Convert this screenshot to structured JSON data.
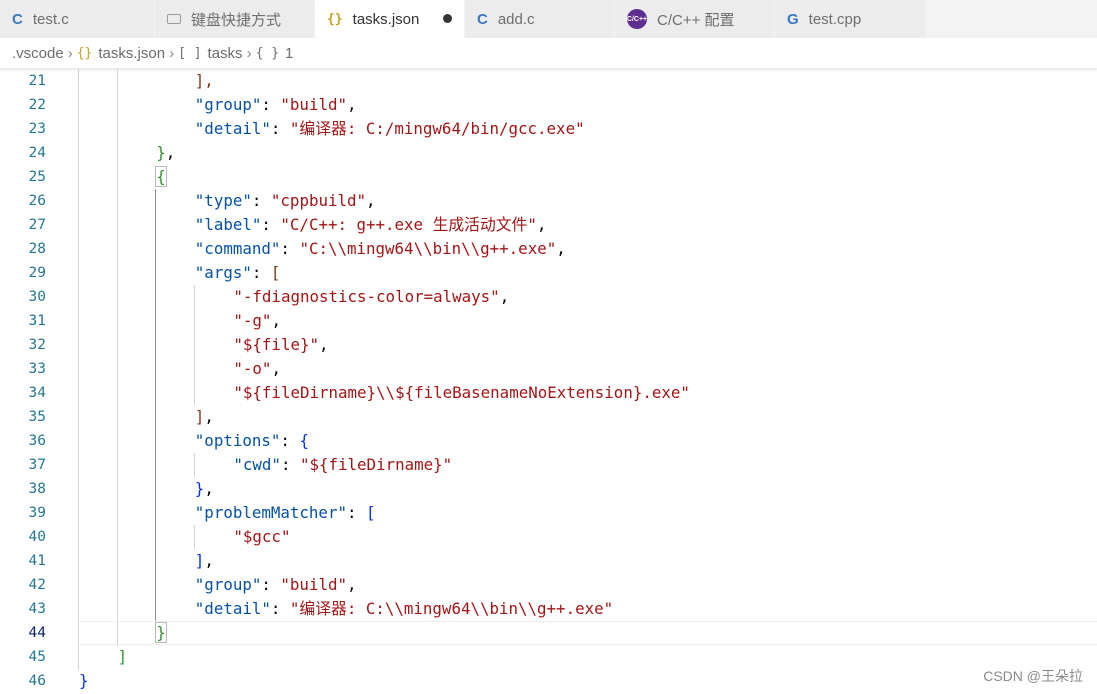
{
  "tabs": [
    {
      "label": "test.c",
      "icon": "c-file-icon",
      "glyph": "C",
      "active": false,
      "dirty": false,
      "width": 155
    },
    {
      "label": "键盘快捷方式",
      "icon": "keyboard-icon",
      "glyph": "",
      "active": false,
      "dirty": false,
      "width": 160
    },
    {
      "label": "tasks.json",
      "icon": "json-file-icon",
      "glyph": "{}",
      "active": true,
      "dirty": true,
      "width": 150
    },
    {
      "label": "add.c",
      "icon": "c-file-icon",
      "glyph": "C",
      "active": false,
      "dirty": false,
      "width": 150
    },
    {
      "label": "C/C++ 配置",
      "icon": "cpp-config-icon",
      "glyph": "C/C++",
      "active": false,
      "dirty": false,
      "width": 160
    },
    {
      "label": "test.cpp",
      "icon": "cpp-file-icon",
      "glyph": "G",
      "active": false,
      "dirty": false,
      "width": 152
    }
  ],
  "breadcrumb": [
    {
      "label": ".vscode",
      "glyph": ""
    },
    {
      "label": "tasks.json",
      "glyph": "{}"
    },
    {
      "label": "tasks",
      "glyph": "[ ]"
    },
    {
      "label": "1",
      "glyph": "{ }"
    }
  ],
  "editor": {
    "current_line": 44,
    "lines": [
      {
        "n": "21",
        "indent": 3,
        "tokens": [
          {
            "t": "],",
            "c": "b3"
          }
        ]
      },
      {
        "n": "22",
        "indent": 3,
        "tokens": [
          {
            "t": "\"group\"",
            "c": "k"
          },
          {
            "t": ": ",
            "c": "p"
          },
          {
            "t": "\"build\"",
            "c": "s"
          },
          {
            "t": ",",
            "c": "p"
          }
        ]
      },
      {
        "n": "23",
        "indent": 3,
        "tokens": [
          {
            "t": "\"detail\"",
            "c": "k"
          },
          {
            "t": ": ",
            "c": "p"
          },
          {
            "t": "\"编译器: C:/mingw64/bin/gcc.exe\"",
            "c": "s"
          }
        ]
      },
      {
        "n": "24",
        "indent": 2,
        "tokens": [
          {
            "t": "}",
            "c": "b2"
          },
          {
            "t": ",",
            "c": "p"
          }
        ]
      },
      {
        "n": "25",
        "indent": 2,
        "tokens": [
          {
            "t": "{",
            "c": "b2",
            "m": true
          }
        ]
      },
      {
        "n": "26",
        "indent": 3,
        "tokens": [
          {
            "t": "\"type\"",
            "c": "k"
          },
          {
            "t": ": ",
            "c": "p"
          },
          {
            "t": "\"cppbuild\"",
            "c": "s"
          },
          {
            "t": ",",
            "c": "p"
          }
        ]
      },
      {
        "n": "27",
        "indent": 3,
        "tokens": [
          {
            "t": "\"label\"",
            "c": "k"
          },
          {
            "t": ": ",
            "c": "p"
          },
          {
            "t": "\"C/C++: g++.exe 生成活动文件\"",
            "c": "s"
          },
          {
            "t": ",",
            "c": "p"
          }
        ]
      },
      {
        "n": "28",
        "indent": 3,
        "tokens": [
          {
            "t": "\"command\"",
            "c": "k"
          },
          {
            "t": ": ",
            "c": "p"
          },
          {
            "t": "\"C:\\\\mingw64\\\\bin\\\\g++.exe\"",
            "c": "s"
          },
          {
            "t": ",",
            "c": "p"
          }
        ]
      },
      {
        "n": "29",
        "indent": 3,
        "tokens": [
          {
            "t": "\"args\"",
            "c": "k"
          },
          {
            "t": ": ",
            "c": "p"
          },
          {
            "t": "[",
            "c": "b3"
          }
        ]
      },
      {
        "n": "30",
        "indent": 4,
        "tokens": [
          {
            "t": "\"-fdiagnostics-color=always\"",
            "c": "s"
          },
          {
            "t": ",",
            "c": "p"
          }
        ]
      },
      {
        "n": "31",
        "indent": 4,
        "tokens": [
          {
            "t": "\"-g\"",
            "c": "s"
          },
          {
            "t": ",",
            "c": "p"
          }
        ]
      },
      {
        "n": "32",
        "indent": 4,
        "tokens": [
          {
            "t": "\"${file}\"",
            "c": "s"
          },
          {
            "t": ",",
            "c": "p"
          }
        ]
      },
      {
        "n": "33",
        "indent": 4,
        "tokens": [
          {
            "t": "\"-o\"",
            "c": "s"
          },
          {
            "t": ",",
            "c": "p"
          }
        ]
      },
      {
        "n": "34",
        "indent": 4,
        "tokens": [
          {
            "t": "\"${fileDirname}\\\\${fileBasenameNoExtension}.exe\"",
            "c": "s"
          }
        ]
      },
      {
        "n": "35",
        "indent": 3,
        "tokens": [
          {
            "t": "]",
            "c": "b3"
          },
          {
            "t": ",",
            "c": "p"
          }
        ]
      },
      {
        "n": "36",
        "indent": 3,
        "tokens": [
          {
            "t": "\"options\"",
            "c": "k"
          },
          {
            "t": ": ",
            "c": "p"
          },
          {
            "t": "{",
            "c": "b1"
          }
        ]
      },
      {
        "n": "37",
        "indent": 4,
        "tokens": [
          {
            "t": "\"cwd\"",
            "c": "k"
          },
          {
            "t": ": ",
            "c": "p"
          },
          {
            "t": "\"${fileDirname}\"",
            "c": "s"
          }
        ]
      },
      {
        "n": "38",
        "indent": 3,
        "tokens": [
          {
            "t": "}",
            "c": "b1"
          },
          {
            "t": ",",
            "c": "p"
          }
        ]
      },
      {
        "n": "39",
        "indent": 3,
        "tokens": [
          {
            "t": "\"problemMatcher\"",
            "c": "k"
          },
          {
            "t": ": ",
            "c": "p"
          },
          {
            "t": "[",
            "c": "b1"
          }
        ]
      },
      {
        "n": "40",
        "indent": 4,
        "tokens": [
          {
            "t": "\"$gcc\"",
            "c": "s"
          }
        ]
      },
      {
        "n": "41",
        "indent": 3,
        "tokens": [
          {
            "t": "]",
            "c": "b1"
          },
          {
            "t": ",",
            "c": "p"
          }
        ]
      },
      {
        "n": "42",
        "indent": 3,
        "tokens": [
          {
            "t": "\"group\"",
            "c": "k"
          },
          {
            "t": ": ",
            "c": "p"
          },
          {
            "t": "\"build\"",
            "c": "s"
          },
          {
            "t": ",",
            "c": "p"
          }
        ]
      },
      {
        "n": "43",
        "indent": 3,
        "tokens": [
          {
            "t": "\"detail\"",
            "c": "k"
          },
          {
            "t": ": ",
            "c": "p"
          },
          {
            "t": "\"编译器: C:\\\\mingw64\\\\bin\\\\g++.exe\"",
            "c": "s"
          }
        ]
      },
      {
        "n": "44",
        "indent": 2,
        "tokens": [
          {
            "t": "}",
            "c": "b2",
            "m": true
          }
        ]
      },
      {
        "n": "45",
        "indent": 1,
        "tokens": [
          {
            "t": "]",
            "c": "b2"
          }
        ]
      },
      {
        "n": "46",
        "indent": 0,
        "tokens": [
          {
            "t": "}",
            "c": "b1"
          }
        ]
      }
    ]
  },
  "watermark": "CSDN @王朵拉"
}
